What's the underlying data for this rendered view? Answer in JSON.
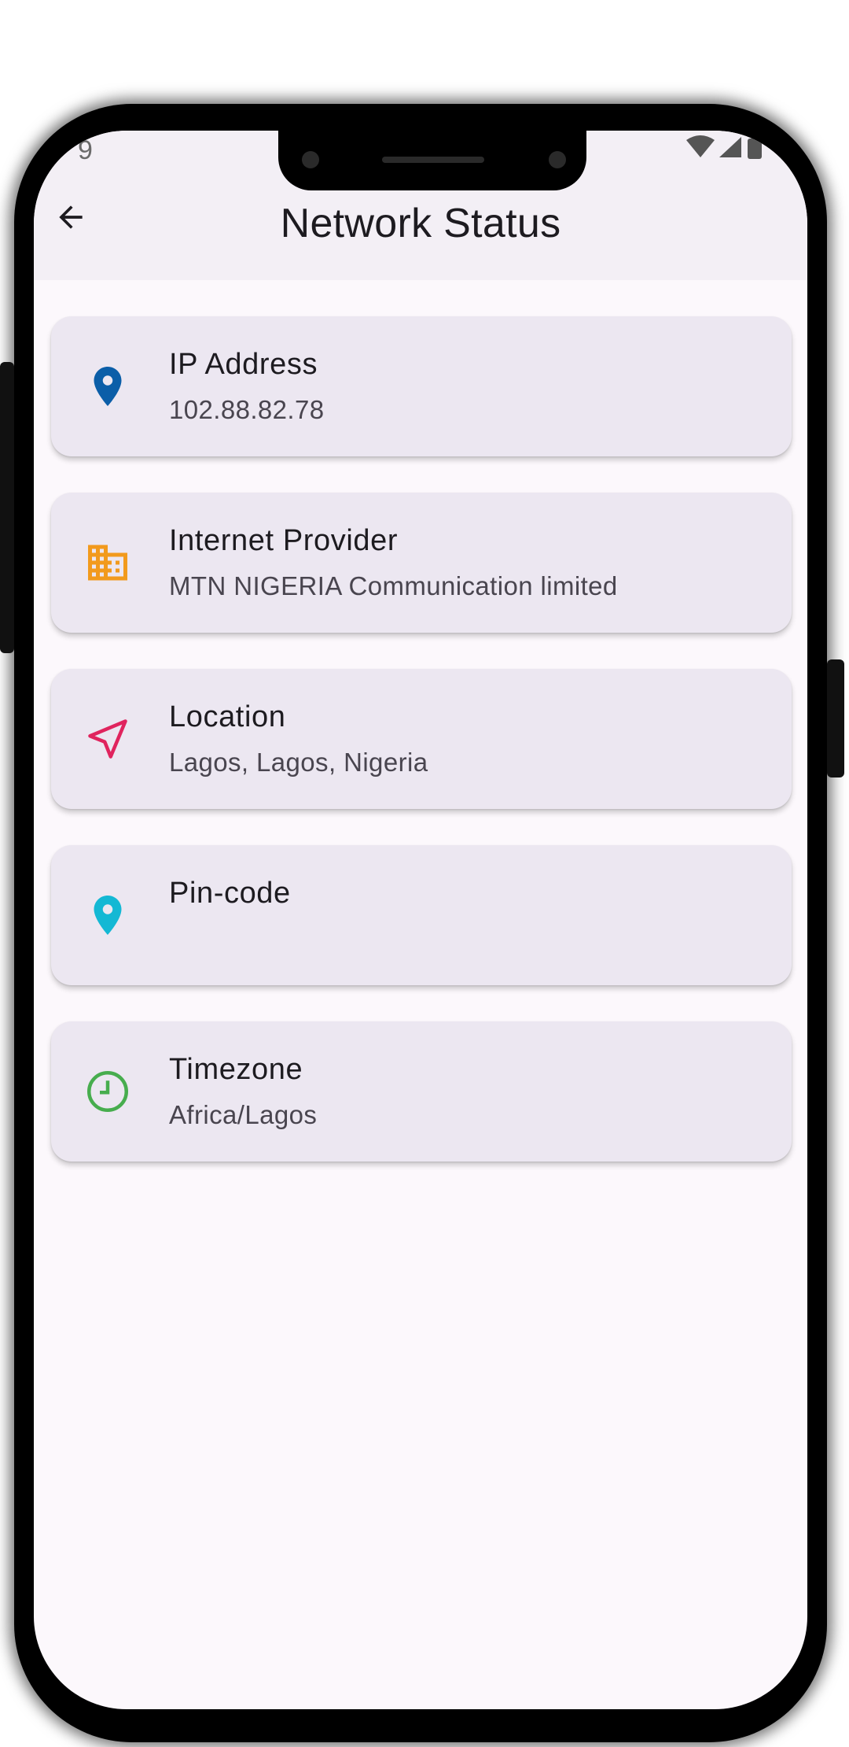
{
  "status_bar": {
    "time": "9"
  },
  "app_bar": {
    "title": "Network Status"
  },
  "items": [
    {
      "label": "IP Address",
      "value": "102.88.82.78",
      "icon": "location-pin-icon",
      "color": "#0b5ea8"
    },
    {
      "label": "Internet Provider",
      "value": "MTN NIGERIA Communication limited",
      "icon": "business-icon",
      "color": "#f29a1d"
    },
    {
      "label": "Location",
      "value": "Lagos, Lagos, Nigeria",
      "icon": "navigation-arrow-icon",
      "color": "#e0245e"
    },
    {
      "label": "Pin-code",
      "value": "",
      "icon": "location-pin-icon",
      "color": "#14b8d4"
    },
    {
      "label": "Timezone",
      "value": "Africa/Lagos",
      "icon": "clock-icon",
      "color": "#47ad4e"
    }
  ]
}
